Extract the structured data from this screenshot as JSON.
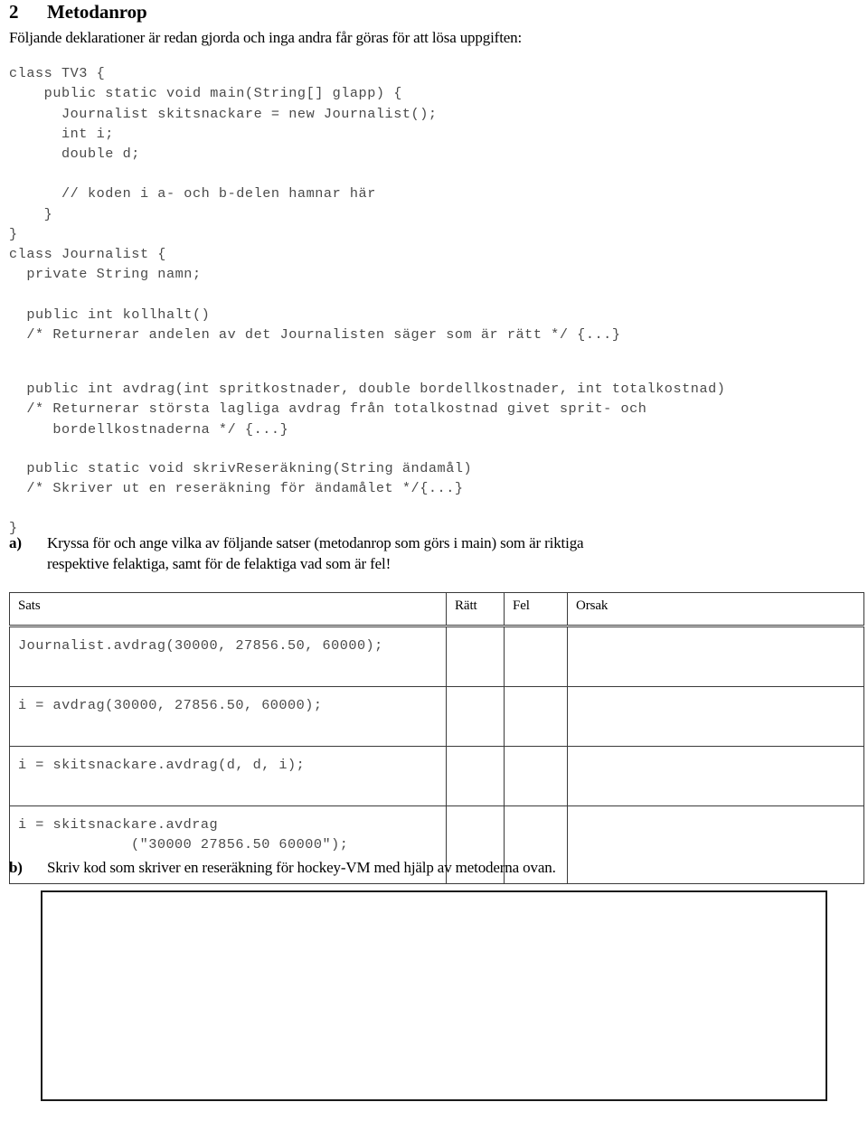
{
  "heading": {
    "number": "2",
    "title": "Metodanrop"
  },
  "intro": "Följande deklarationer är redan gjorda och inga andra får göras för att lösa uppgiften:",
  "code": {
    "main_block": "class TV3 {\n    public static void main(String[] glapp) {\n      Journalist skitsnackare = new Journalist();\n      int i;\n      double d;\n\n      // koden i a- och b-delen hamnar här\n    }\n}",
    "class_block": "class Journalist {\n  private String namn;\n\n  public int kollhalt()\n  /* Returnerar andelen av det Journalisten säger som är rätt */ {...}",
    "avdrag_block": "  public int avdrag(int spritkostnader, double bordellkostnader, int totalkostnad)\n  /* Returnerar största lagliga avdrag från totalkostnad givet sprit- och\n     bordellkostnaderna */ {...}",
    "skriv_block": "  public static void skrivReseräkning(String ändamål)\n  /* Skriver ut en reseräkning för ändamålet */{...}",
    "close_brace": "}"
  },
  "part_a": {
    "label": "a)",
    "line1": "Kryssa för och ange vilka av följande satser (metodanrop som görs i main) som är riktiga",
    "line2": "respektive felaktiga, samt för de felaktiga vad som är fel!"
  },
  "table": {
    "columns": [
      "Sats",
      "Rätt",
      "Fel",
      "Orsak"
    ],
    "rows": [
      {
        "sats": "Journalist.avdrag(30000, 27856.50, 60000);",
        "ratt": "",
        "fel": "",
        "orsak": ""
      },
      {
        "sats": "i = avdrag(30000, 27856.50, 60000);",
        "ratt": "",
        "fel": "",
        "orsak": ""
      },
      {
        "sats": "i = skitsnackare.avdrag(d, d, i);",
        "ratt": "",
        "fel": "",
        "orsak": ""
      },
      {
        "sats": "i = skitsnackare.avdrag\n             (\"30000 27856.50 60000\");",
        "ratt": "",
        "fel": "",
        "orsak": ""
      }
    ]
  },
  "part_b": {
    "label": "b)",
    "line1": "Skriv kod som skriver en reseräkning för hockey-VM med hjälp av metoderna ovan."
  },
  "colors": {
    "text": "#000000",
    "code_text": "#4a4a4a",
    "rule": "#3a3a3a",
    "answer_box_border": "#1a1a1a"
  }
}
